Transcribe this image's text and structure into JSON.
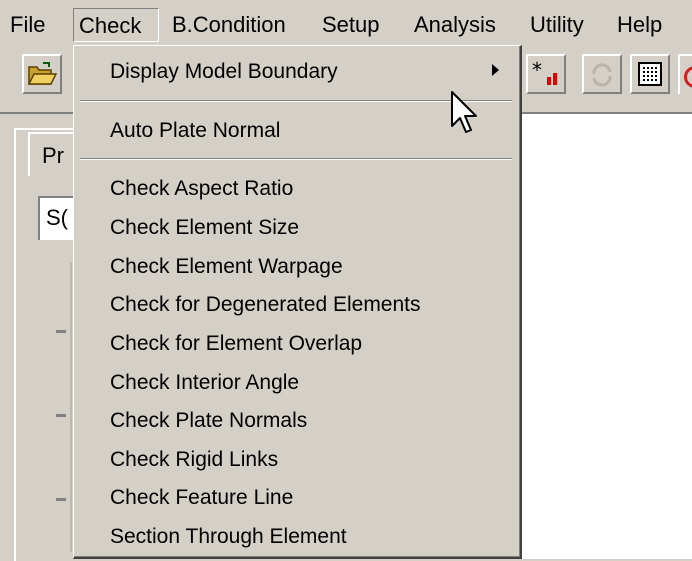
{
  "menubar": {
    "items": [
      "File",
      "Check",
      "B.Condition",
      "Setup",
      "Analysis",
      "Utility",
      "Help"
    ],
    "open_item": "Check"
  },
  "panel": {
    "tab_label": "Pr",
    "select_value": "S("
  },
  "menu": {
    "display_model_boundary": "Display Model Boundary",
    "auto_plate_normal": "Auto Plate Normal",
    "checks": [
      "Check Aspect Ratio",
      "Check Element Size",
      "Check Element Warpage",
      "Check for Degenerated Elements",
      "Check for Element Overlap",
      "Check Interior Angle",
      "Check Plate Normals",
      "Check Rigid Links",
      "Check Feature Line",
      "Section Through Element"
    ]
  },
  "toolbar": {
    "icons": [
      "open-folder-icon",
      "star-chart-icon",
      "rotate-icon",
      "grid-icon"
    ]
  },
  "colors": {
    "face": "#d4d0c8",
    "shadow": "#808080",
    "highlight": "#ffffff",
    "canvas": "#ffffff"
  }
}
